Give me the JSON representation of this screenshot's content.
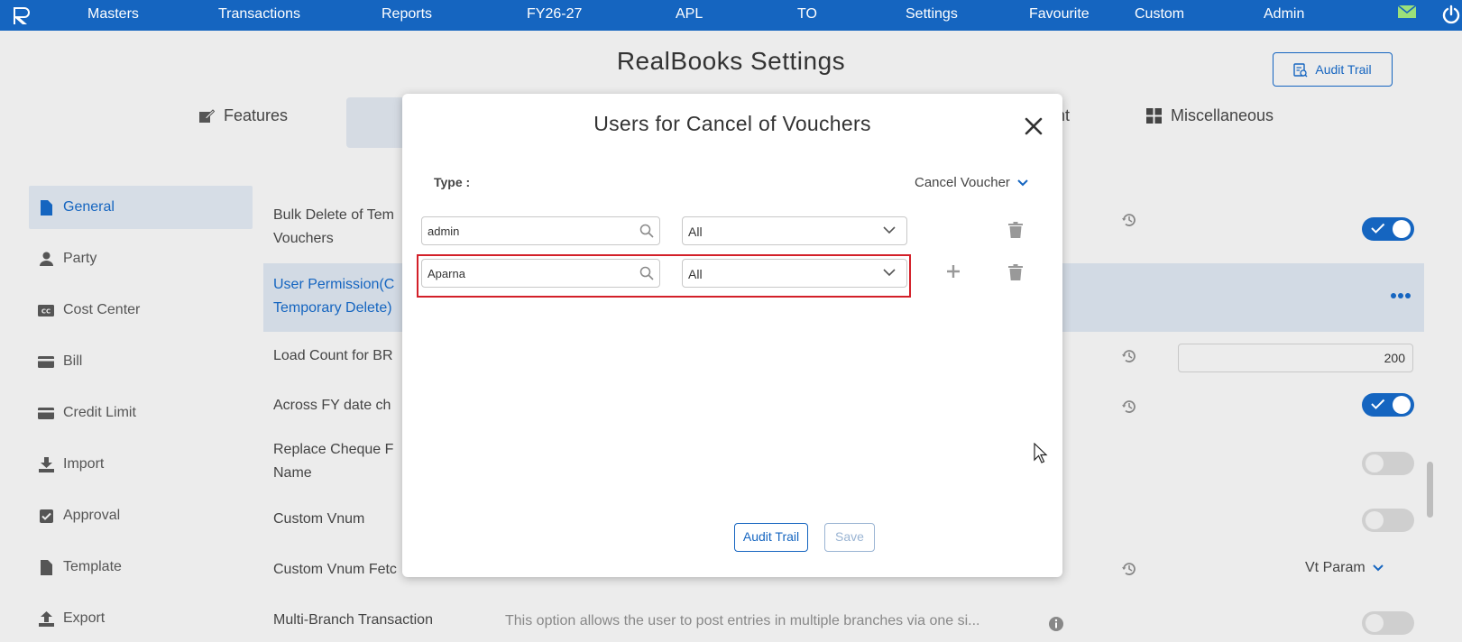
{
  "topnav": {
    "items": [
      "Masters",
      "Transactions",
      "Reports",
      "FY26-27",
      "APL",
      "TO",
      "Settings",
      "Favourite",
      "Custom",
      "Admin"
    ]
  },
  "page": {
    "title": "RealBooks Settings",
    "audit_trail_label": "Audit Trail"
  },
  "tabs": {
    "features": "Features",
    "partial_right": "nt",
    "miscellaneous": "Miscellaneous"
  },
  "sidebar": {
    "items": [
      {
        "label": "General",
        "icon": "document-icon"
      },
      {
        "label": "Party",
        "icon": "person-icon"
      },
      {
        "label": "Cost Center",
        "icon": "cc-icon"
      },
      {
        "label": "Bill",
        "icon": "card-icon"
      },
      {
        "label": "Credit Limit",
        "icon": "card-icon"
      },
      {
        "label": "Import",
        "icon": "download-icon"
      },
      {
        "label": "Approval",
        "icon": "checkbox-icon"
      },
      {
        "label": "Template",
        "icon": "document-icon"
      },
      {
        "label": "Export",
        "icon": "upload-icon"
      }
    ]
  },
  "settings": {
    "bulk_delete": [
      "Bulk Delete of Tem",
      "Vouchers"
    ],
    "user_permission": [
      "User Permission(C",
      "Temporary Delete)"
    ],
    "load_count": "Load Count for BR",
    "load_count_value": "200",
    "across_fy": "Across FY date ch",
    "replace_cheque": [
      "Replace Cheque F",
      "Name"
    ],
    "custom_vnum": "Custom Vnum",
    "custom_vnum_fetch": "Custom Vnum Fetc",
    "custom_vnum_fetch_value": "Vt Param",
    "multi_branch": "Multi-Branch Transaction",
    "multi_branch_desc": "This option allows the user to post entries in multiple branches via one si..."
  },
  "modal": {
    "title": "Users for Cancel of Vouchers",
    "type_label": "Type :",
    "type_value": "Cancel Voucher",
    "rows": [
      {
        "user": "admin",
        "permission": "All"
      },
      {
        "user": "Aparna",
        "permission": "All"
      }
    ],
    "audit_trail_label": "Audit Trail",
    "save_label": "Save"
  },
  "colors": {
    "brand": "#1565c0",
    "highlight": "#d32029"
  }
}
